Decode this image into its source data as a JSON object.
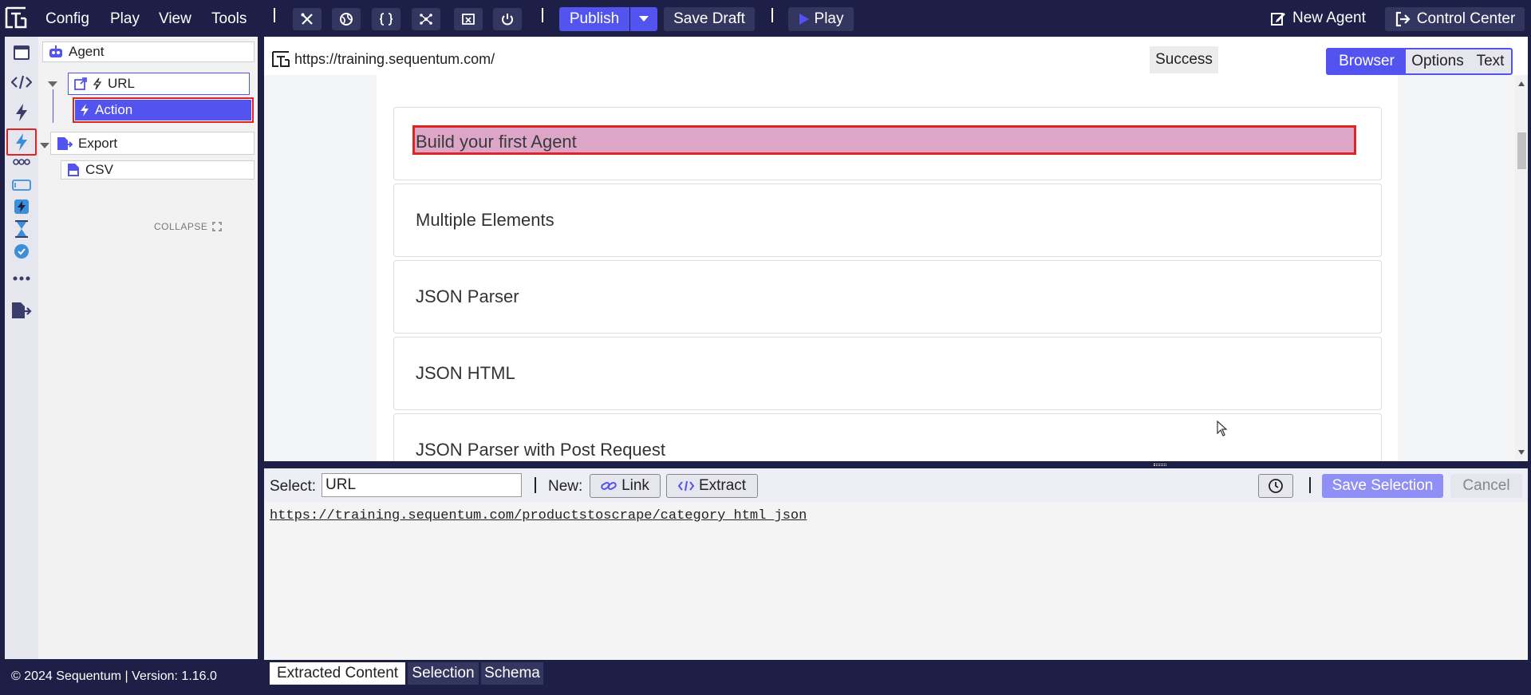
{
  "topbar": {
    "menu": [
      "Config",
      "Play",
      "View",
      "Tools"
    ],
    "publish_label": "Publish",
    "save_draft_label": "Save Draft",
    "play_label": "Play",
    "new_agent_label": "New Agent",
    "control_center_label": "Control Center"
  },
  "tree": {
    "agent_label": "Agent",
    "url_label": "URL",
    "action_label": "Action",
    "export_label": "Export",
    "csv_label": "CSV",
    "collapse_label": "COLLAPSE"
  },
  "footer": {
    "copyright": "© 2024 Sequentum | Version: 1.16.0"
  },
  "browser": {
    "url": "https://training.sequentum.com/",
    "status": "Success",
    "views": [
      "Browser",
      "Options",
      "Text"
    ],
    "active_view": "Browser",
    "cards": [
      "Build your first Agent",
      "Multiple Elements",
      "JSON Parser",
      "JSON HTML",
      "JSON Parser with Post Request"
    ]
  },
  "selection": {
    "select_label": "Select:",
    "select_value": "URL",
    "new_label": "New:",
    "link_label": "Link",
    "extract_label": "Extract",
    "save_selection_label": "Save Selection",
    "cancel_label": "Cancel",
    "extracted_url": "https://training.sequentum.com/productstoscrape/category_html_json"
  },
  "bottom_tabs": [
    "Extracted Content",
    "Selection",
    "Schema"
  ],
  "colors": {
    "navy": "#1d1f47",
    "accent": "#5353f0",
    "highlight_border": "#e02424",
    "highlight_fill": "#dda6c9"
  }
}
